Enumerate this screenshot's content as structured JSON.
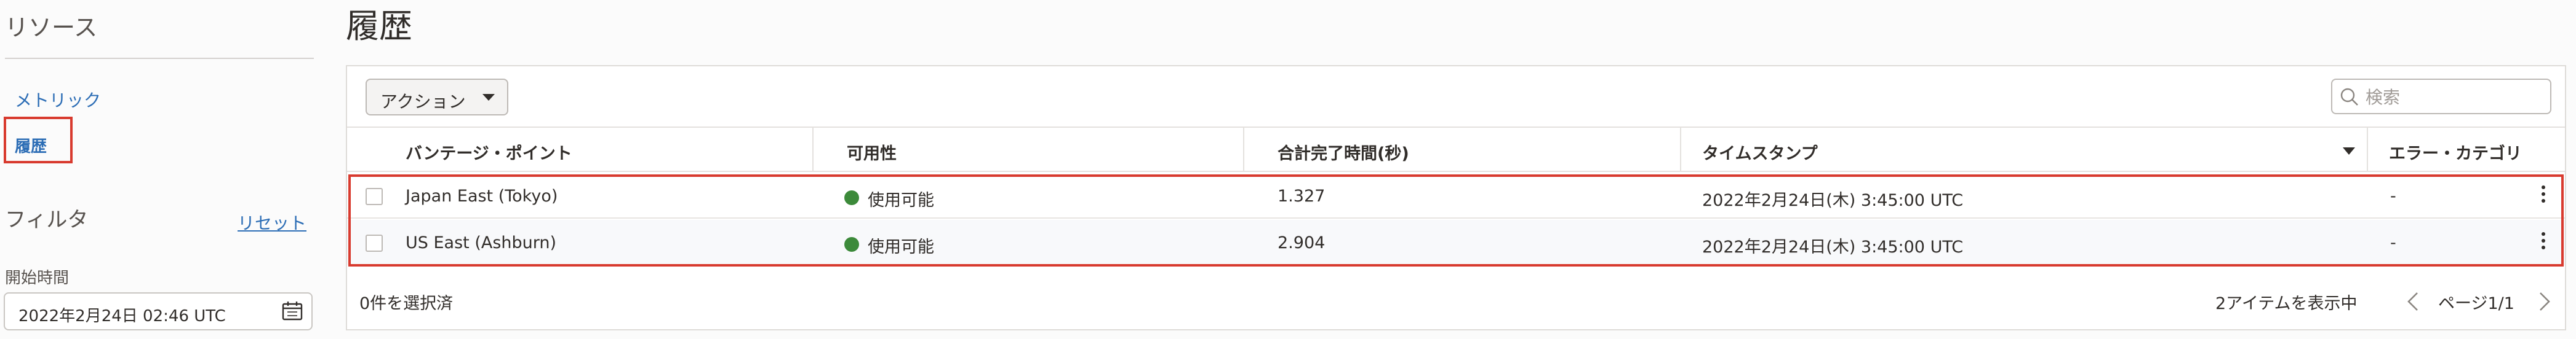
{
  "sidebar": {
    "resources_title": "リソース",
    "items": [
      {
        "label": "メトリック"
      },
      {
        "label": "履歴"
      }
    ],
    "filter_title": "フィルタ",
    "reset_label": "リセット",
    "start_time_label": "開始時間",
    "start_time_value": "2022年2月24日 02:46 UTC"
  },
  "main": {
    "title": "履歴",
    "actions_label": "アクション",
    "search_placeholder": "検索",
    "columns": [
      "バンテージ・ポイント",
      "可用性",
      "合計完了時間(秒)",
      "タイムスタンプ",
      "エラー・カテゴリ"
    ],
    "rows": [
      {
        "vantage": "Japan East (Tokyo)",
        "availability": "使用可能",
        "time": "1.327",
        "timestamp": "2022年2月24日(木) 3:45:00 UTC",
        "error": "-"
      },
      {
        "vantage": "US East (Ashburn)",
        "availability": "使用可能",
        "time": "2.904",
        "timestamp": "2022年2月24日(木) 3:45:00 UTC",
        "error": "-"
      }
    ],
    "footer": {
      "selected": "0件を選択済",
      "items_shown": "2アイテムを表示中",
      "page": "ページ1/1"
    }
  },
  "icons": {
    "calendar": "calendar-icon",
    "search": "search-icon",
    "sort": "sort-descending-icon",
    "row_menu": "more-vertical-icon",
    "prev": "chevron-left-icon",
    "next": "chevron-right-icon"
  },
  "colors": {
    "link": "#2c6db5",
    "highlight": "#d83a2e",
    "available": "#3c8a3a"
  }
}
